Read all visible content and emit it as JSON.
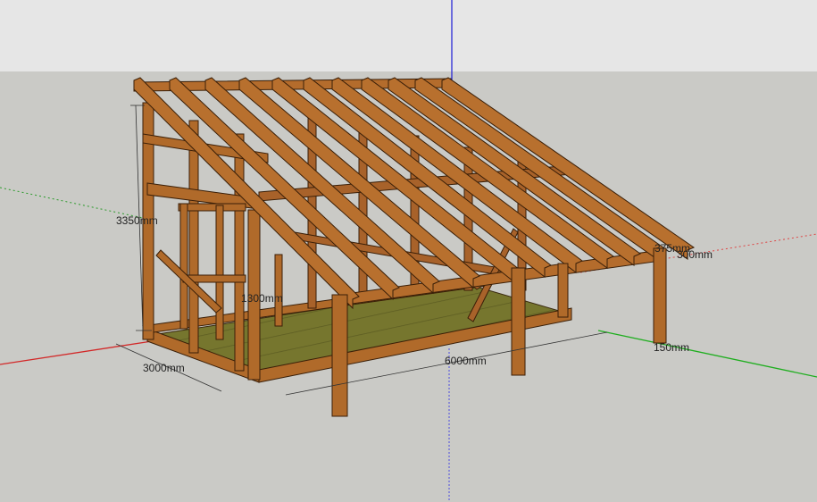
{
  "colors": {
    "sky": "#e8e8e8",
    "ground": "#cacac6",
    "timber": "#b06a2a",
    "timber_dark": "#6b3a12",
    "floor": "#7a7a32",
    "axis_red": "#d22828",
    "axis_green": "#1fae1f",
    "axis_blue": "#2b2bd6"
  },
  "dimensions": {
    "height": "3350mm",
    "depth": "3000mm",
    "length": "6000mm",
    "post_inner": "1300mm",
    "overhang": "150mm",
    "right_top_a": "375mm",
    "right_top_b": "300mm"
  }
}
